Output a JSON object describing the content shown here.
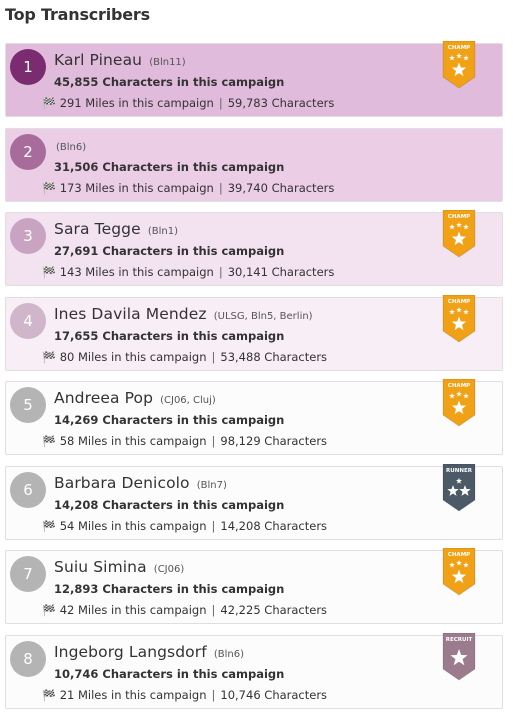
{
  "page_title": "Top Transcribers",
  "flag_icon": "checkered-flag-icon",
  "transcribers": [
    {
      "rank": "1",
      "name": "Karl Pineau",
      "group": "(Bln11)",
      "chars": "45,855 Characters in this campaign",
      "miles": "291 Miles in this campaign",
      "total": "59,783 Characters",
      "badge": "CHAMP",
      "bg": "#e1bbdb",
      "rank_color": "#7b2b6f"
    },
    {
      "rank": "2",
      "name": "",
      "group": "(Bln6)",
      "chars": "31,506 Characters in this campaign",
      "miles": "173 Miles in this campaign",
      "total": "39,740 Characters",
      "badge": "",
      "bg": "#ebcde6",
      "rank_color": "#a76b9c"
    },
    {
      "rank": "3",
      "name": "Sara Tegge",
      "group": "(Bln1)",
      "chars": "27,691 Characters in this campaign",
      "miles": "143 Miles in this campaign",
      "total": "30,141 Characters",
      "badge": "CHAMP",
      "bg": "#f3e3f1",
      "rank_color": "#c9a3c2"
    },
    {
      "rank": "4",
      "name": "Ines Davila Mendez",
      "group": "(ULSG, Bln5, Berlin)",
      "chars": "17,655 Characters in this campaign",
      "miles": "80 Miles in this campaign",
      "total": "53,488 Characters",
      "badge": "CHAMP",
      "bg": "#f7eef6",
      "rank_color": "#cfb6cb"
    },
    {
      "rank": "5",
      "name": "Andreea Pop",
      "group": "(CJ06, Cluj)",
      "chars": "14,269 Characters in this campaign",
      "miles": "58 Miles in this campaign",
      "total": "98,129 Characters",
      "badge": "CHAMP",
      "bg": "#fdfcfd",
      "rank_color": "#b4b4b4"
    },
    {
      "rank": "6",
      "name": "Barbara Denicolo",
      "group": "(Bln7)",
      "chars": "14,208 Characters in this campaign",
      "miles": "54 Miles in this campaign",
      "total": "14,208 Characters",
      "badge": "RUNNER",
      "bg": "#fdfcfd",
      "rank_color": "#b4b4b4"
    },
    {
      "rank": "7",
      "name": "Suiu Simina",
      "group": "(CJ06)",
      "chars": "12,893 Characters in this campaign",
      "miles": "42 Miles in this campaign",
      "total": "42,225 Characters",
      "badge": "CHAMP",
      "bg": "#fdfcfd",
      "rank_color": "#b4b4b4"
    },
    {
      "rank": "8",
      "name": "Ingeborg Langsdorf",
      "group": "(Bln6)",
      "chars": "10,746 Characters in this campaign",
      "miles": "21 Miles in this campaign",
      "total": "10,746 Characters",
      "badge": "RECRUIT",
      "bg": "#fdfcfd",
      "rank_color": "#b4b4b4"
    }
  ],
  "badge_colors": {
    "CHAMP": "#f0a116",
    "RUNNER": "#4b5a66",
    "RECRUIT": "#9b7b8e"
  }
}
